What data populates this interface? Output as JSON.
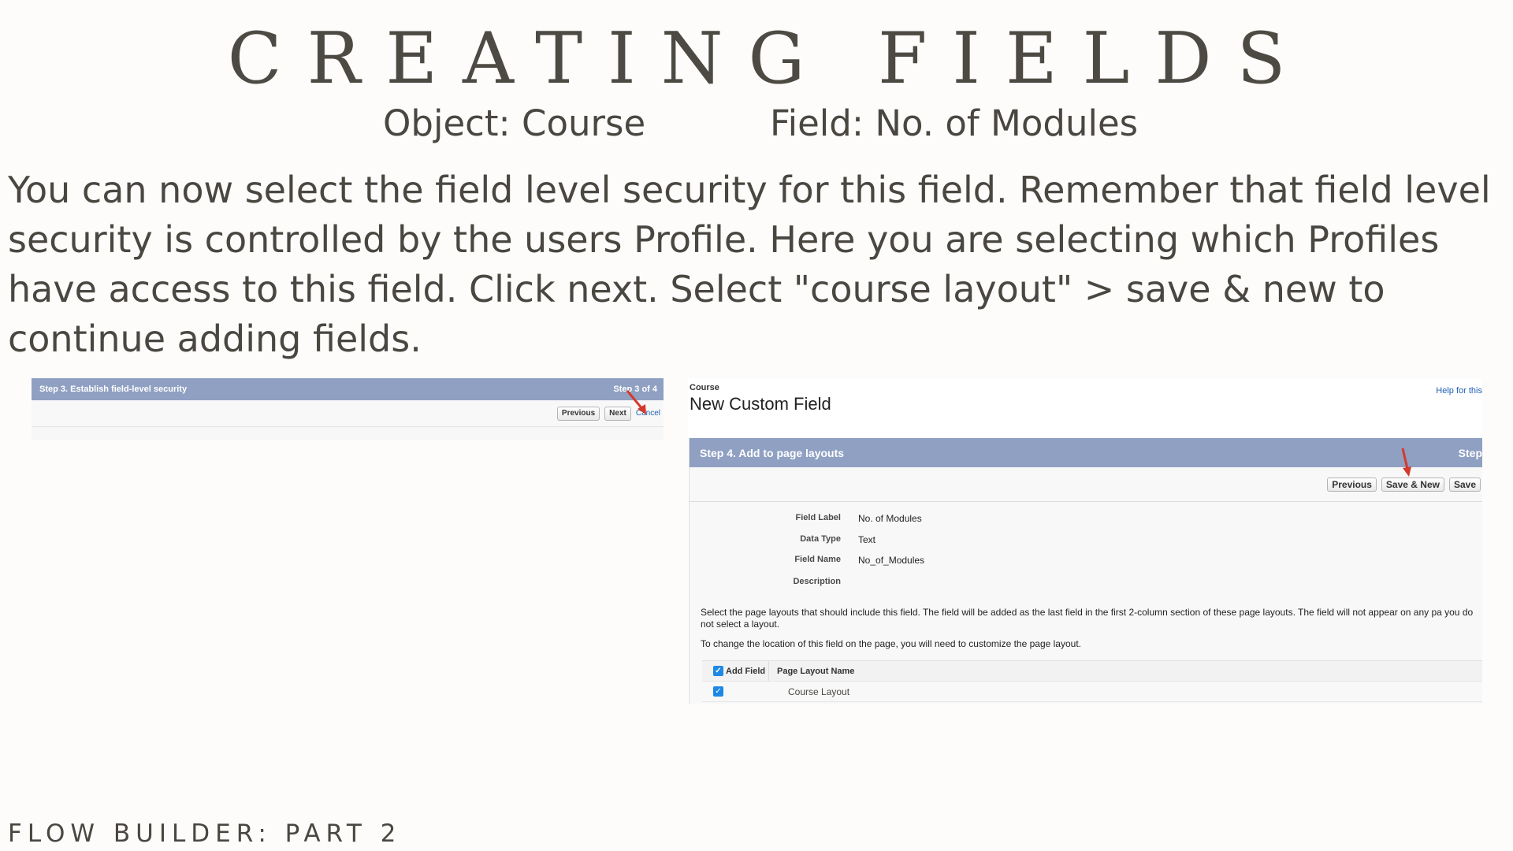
{
  "title": "CREATING FIELDS",
  "subtitle": {
    "object": "Object: Course",
    "field": "Field: No. of Modules"
  },
  "body_text": "You can now select the field level security for this field. Remember that field level security is controlled by the users Profile. Here you are selecting which Profiles have access to this field. Click next. Select \"course layout\" > save & new to continue adding fields.",
  "footer": "FLOW BUILDER: PART 2",
  "screenshot_step3": {
    "header": "Step 3. Establish field-level security",
    "step": "Step 3 of 4",
    "buttons": {
      "previous": "Previous",
      "next": "Next",
      "cancel": "Cancel"
    }
  },
  "screenshot_step4": {
    "breadcrumb": "Course",
    "page_title": "New Custom Field",
    "help_link": "Help for this",
    "header": "Step 4. Add to page layouts",
    "step": "Step",
    "buttons": {
      "previous": "Previous",
      "save_new": "Save & New",
      "save": "Save"
    },
    "fields": [
      {
        "label": "Field Label",
        "value": "No. of Modules"
      },
      {
        "label": "Data Type",
        "value": "Text"
      },
      {
        "label": "Field Name",
        "value": "No_of_Modules"
      },
      {
        "label": "Description",
        "value": ""
      }
    ],
    "instructions": "Select the page layouts that should include this field. The field will be added as the last field in the first 2-column section of these page layouts. The field will not appear on any pa you do not select a layout.",
    "instructions_2": "To change the location of this field on the page, you will need to customize the page layout.",
    "table": {
      "headers": [
        "Add Field",
        "Page Layout Name"
      ],
      "rows": [
        {
          "checked": true,
          "name": "Course Layout"
        }
      ]
    }
  },
  "colors": {
    "bar": "#8fa0c2",
    "arrow": "#d33a2c",
    "checkbox": "#1e88e5",
    "text": "#4a4741"
  }
}
